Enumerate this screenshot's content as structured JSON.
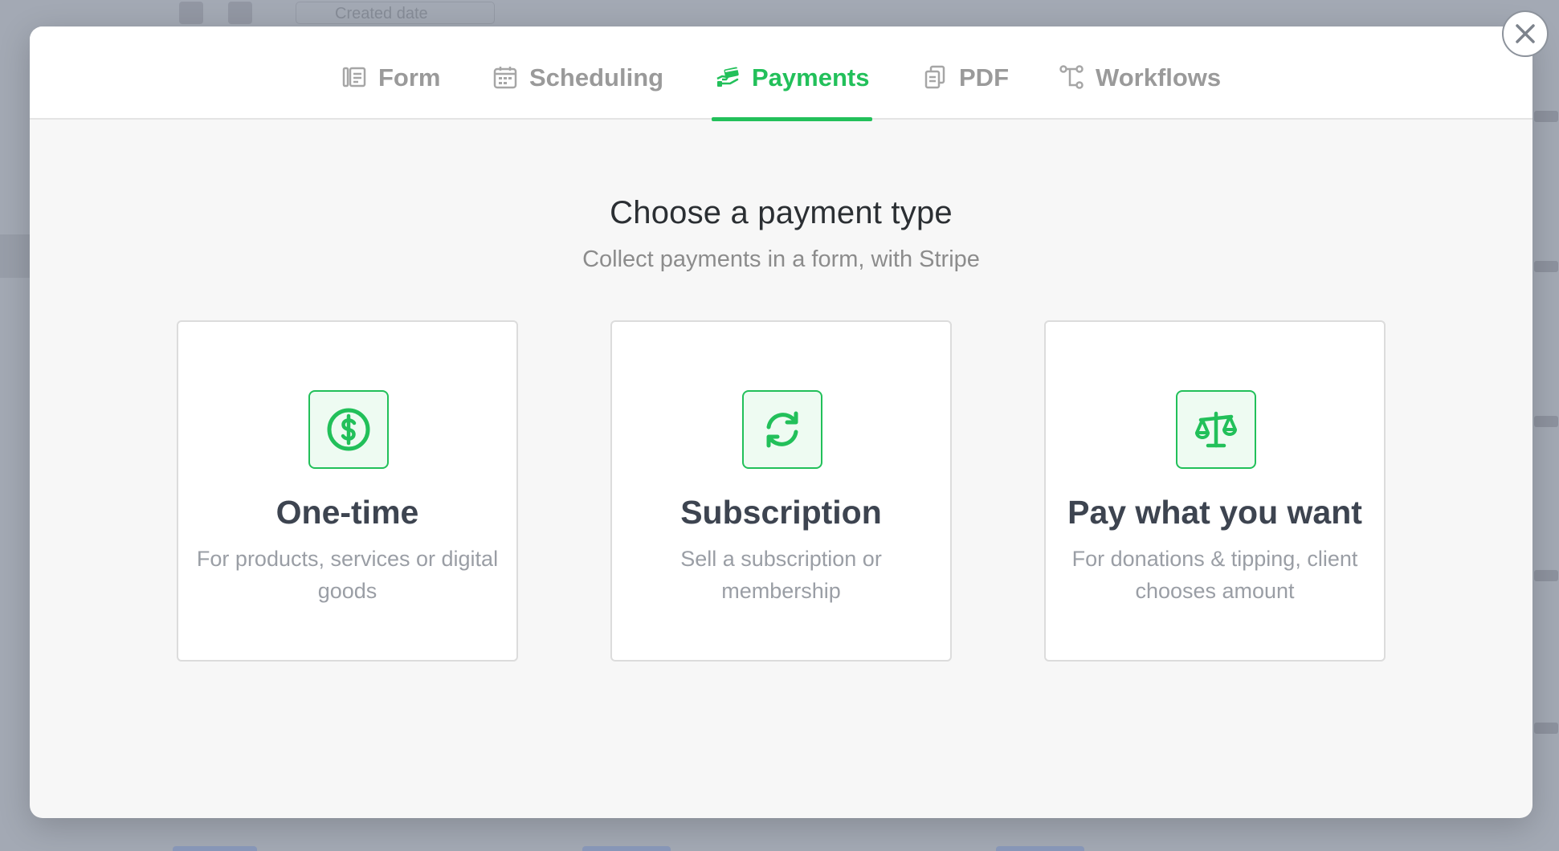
{
  "tabs": [
    {
      "label": "Form",
      "icon": "form-icon",
      "active": false
    },
    {
      "label": "Scheduling",
      "icon": "calendar-icon",
      "active": false
    },
    {
      "label": "Payments",
      "icon": "payments-icon",
      "active": true
    },
    {
      "label": "PDF",
      "icon": "pdf-icon",
      "active": false
    },
    {
      "label": "Workflows",
      "icon": "workflows-icon",
      "active": false
    }
  ],
  "heading": "Choose a payment type",
  "subheading": "Collect payments in a form, with Stripe",
  "cards": [
    {
      "title": "One-time",
      "description": "For products, services or digital goods",
      "icon": "dollar-circle-icon"
    },
    {
      "title": "Subscription",
      "description": "Sell a subscription or membership",
      "icon": "refresh-icon"
    },
    {
      "title": "Pay what you want",
      "description": "For donations & tipping, client chooses amount",
      "icon": "scales-icon"
    }
  ],
  "background": {
    "date_filter_label": "Created date"
  },
  "colors": {
    "accent": "#22c05a",
    "tab_inactive": "#9a9a9a",
    "modal_bg": "#f7f7f7"
  }
}
